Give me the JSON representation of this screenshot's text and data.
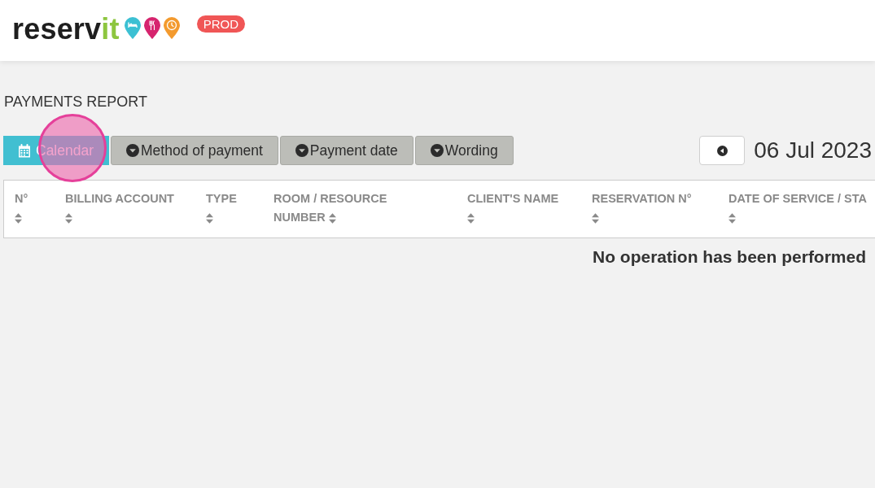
{
  "header": {
    "logo": {
      "text": "reserv",
      "accent_text": "it"
    },
    "environment_badge": "PROD"
  },
  "page_title": "PAYMENTS REPORT",
  "filters": [
    {
      "kind": "calendar",
      "label": "Calendar",
      "selected": true,
      "highlighted": true
    },
    {
      "kind": "dropdown",
      "label": "Method of payment",
      "selected": false,
      "highlighted": false
    },
    {
      "kind": "dropdown",
      "label": "Payment date",
      "selected": false,
      "highlighted": false
    },
    {
      "kind": "dropdown",
      "label": "Wording",
      "selected": false,
      "highlighted": false
    }
  ],
  "date_nav": {
    "date": "06 Jul 2023"
  },
  "table": {
    "columns": [
      "N°",
      "BILLING ACCOUNT",
      "TYPE",
      "ROOM / RESOURCE NUMBER",
      "CLIENT'S NAME",
      "RESERVATION N°",
      "DATE OF SERVICE / STA"
    ],
    "empty_message": "No operation has been performed"
  }
}
